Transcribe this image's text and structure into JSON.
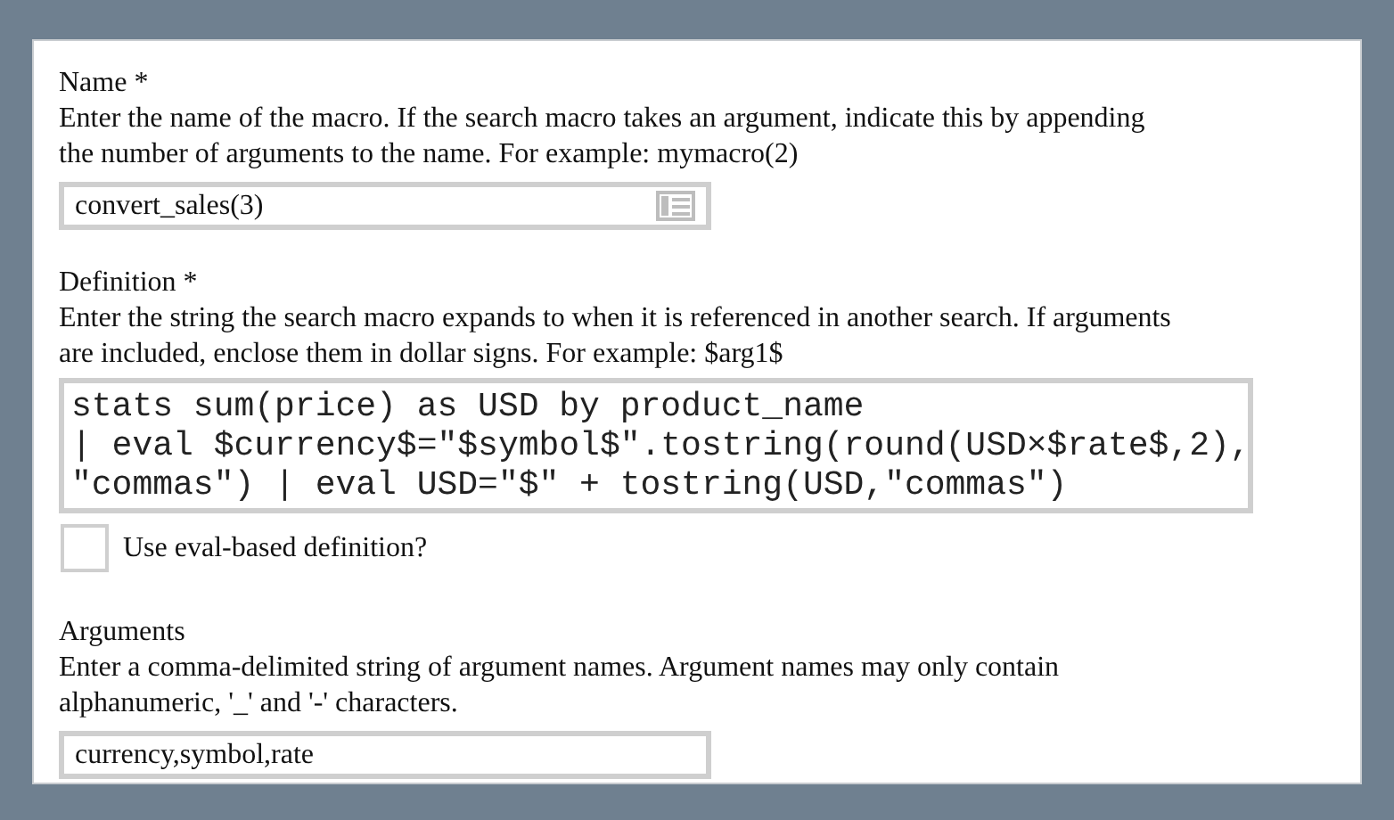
{
  "name": {
    "label": "Name *",
    "help": [
      "Enter the name of the macro. If the search macro takes an argument, indicate this by appending",
      "the number of arguments to the name. For example: mymacro(2)"
    ],
    "value": "convert_sales(3)"
  },
  "definition": {
    "label": "Definition *",
    "help": [
      "Enter the string the search macro expands to when it is referenced in another search. If arguments",
      "are included, enclose them in dollar signs. For example: $arg1$"
    ],
    "value_lines": [
      "stats sum(price) as USD by product_name",
      "| eval $currency$=\"$symbol$\".tostring(round(USD×$rate$,2),",
      "\"commas\") | eval USD=\"$\" + tostring(USD,\"commas\")"
    ]
  },
  "eval_based": {
    "label": "Use eval-based definition?",
    "checked": false
  },
  "arguments": {
    "label": "Arguments",
    "help": [
      "Enter a comma-delimited string of argument names. Argument names may only contain",
      "alphanumeric, '_' and '-' characters."
    ],
    "value": "currency,symbol,rate"
  }
}
